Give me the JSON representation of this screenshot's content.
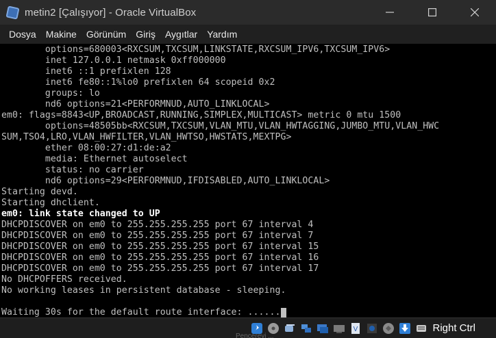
{
  "window": {
    "title": "metin2 [Çalışıyor] - Oracle VirtualBox",
    "icon": "virtualbox-icon"
  },
  "menu": {
    "items": [
      "Dosya",
      "Makine",
      "Görünüm",
      "Giriş",
      "Aygıtlar",
      "Yardım"
    ]
  },
  "terminal": {
    "lines": [
      {
        "text": "        options=680003<RXCSUM,TXCSUM,LINKSTATE,RXCSUM_IPV6,TXCSUM_IPV6>",
        "bright": false
      },
      {
        "text": "        inet 127.0.0.1 netmask 0xff000000",
        "bright": false
      },
      {
        "text": "        inet6 ::1 prefixlen 128",
        "bright": false
      },
      {
        "text": "        inet6 fe80::1%lo0 prefixlen 64 scopeid 0x2",
        "bright": false
      },
      {
        "text": "        groups: lo",
        "bright": false
      },
      {
        "text": "        nd6 options=21<PERFORMNUD,AUTO_LINKLOCAL>",
        "bright": false
      },
      {
        "text": "em0: flags=8843<UP,BROADCAST,RUNNING,SIMPLEX,MULTICAST> metric 0 mtu 1500",
        "bright": false
      },
      {
        "text": "        options=48505bb<RXCSUM,TXCSUM,VLAN_MTU,VLAN_HWTAGGING,JUMBO_MTU,VLAN_HWC",
        "bright": false
      },
      {
        "text": "SUM,TSO4,LRO,VLAN_HWFILTER,VLAN_HWTSO,HWSTATS,MEXTPG>",
        "bright": false
      },
      {
        "text": "        ether 08:00:27:d1:de:a2",
        "bright": false
      },
      {
        "text": "        media: Ethernet autoselect",
        "bright": false
      },
      {
        "text": "        status: no carrier",
        "bright": false
      },
      {
        "text": "        nd6 options=29<PERFORMNUD,IFDISABLED,AUTO_LINKLOCAL>",
        "bright": false
      },
      {
        "text": "Starting devd.",
        "bright": false
      },
      {
        "text": "Starting dhclient.",
        "bright": false
      },
      {
        "text": "em0: link state changed to UP",
        "bright": true
      },
      {
        "text": "DHCPDISCOVER on em0 to 255.255.255.255 port 67 interval 4",
        "bright": false
      },
      {
        "text": "DHCPDISCOVER on em0 to 255.255.255.255 port 67 interval 7",
        "bright": false
      },
      {
        "text": "DHCPDISCOVER on em0 to 255.255.255.255 port 67 interval 15",
        "bright": false
      },
      {
        "text": "DHCPDISCOVER on em0 to 255.255.255.255 port 67 interval 16",
        "bright": false
      },
      {
        "text": "DHCPDISCOVER on em0 to 255.255.255.255 port 67 interval 17",
        "bright": false
      },
      {
        "text": "No DHCPOFFERS received.",
        "bright": false
      },
      {
        "text": "No working leases in persistent database - sleeping.",
        "bright": false
      },
      {
        "text": "",
        "bright": false
      },
      {
        "text": "Waiting 30s for the default route interface: ......",
        "bright": false
      }
    ]
  },
  "statusbar": {
    "icons": [
      "optical-drive-icon",
      "hard-disk-icon",
      "audio-icon",
      "network-icon",
      "shared-folders-icon",
      "display-icon",
      "usb-icon",
      "recording-icon",
      "cpu-icon",
      "mouse-integration-icon",
      "keyboard-icon"
    ],
    "host_key": "Right Ctrl",
    "underbar_text": "Pencereyi ..."
  },
  "colors": {
    "titlebar": "#2b2b2b",
    "menubar": "#202020",
    "terminal_bg": "#000000",
    "terminal_fg": "#c0c0c0",
    "terminal_bright": "#ffffff",
    "statusbar": "#1e1e1e"
  }
}
